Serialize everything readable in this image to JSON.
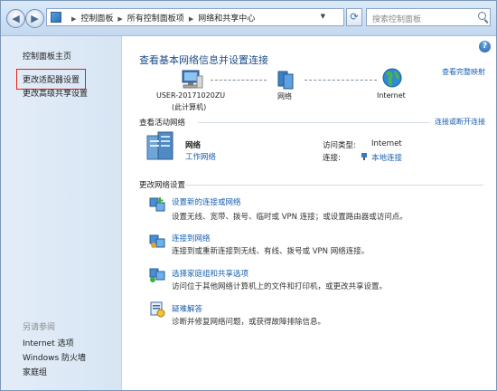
{
  "address_bar": {
    "breadcrumbs": [
      "控制面板",
      "所有控制面板项",
      "网络和共享中心"
    ],
    "search_placeholder": "搜索控制面板"
  },
  "sidebar": {
    "home": "控制面板主页",
    "adapter_settings": "更改适配器设置",
    "advanced_sharing": "更改高级共享设置",
    "see_also_title": "另请参阅",
    "see_also": [
      "Internet 选项",
      "Windows 防火墙",
      "家庭组"
    ]
  },
  "main": {
    "title": "查看基本网络信息并设置连接",
    "view_full_map": "查看完整映射",
    "map": {
      "computer_name": "USER-20171020ZU",
      "computer_sub": "(此计算机)",
      "network": "网络",
      "internet": "Internet"
    },
    "active": {
      "title": "查看活动网络",
      "connect_link": "连接或断开连接",
      "network_name": "网络",
      "network_type": "工作网络",
      "access_type_label": "访问类型:",
      "access_type_value": "Internet",
      "connections_label": "连接:",
      "connections_value": "本地连接"
    },
    "change": {
      "title": "更改网络设置",
      "tasks": [
        {
          "link": "设置新的连接或网络",
          "desc": "设置无线、宽带、拨号、临时或 VPN 连接；或设置路由器或访问点。"
        },
        {
          "link": "连接到网络",
          "desc": "连接到或重新连接到无线、有线、拨号或 VPN 网络连接。"
        },
        {
          "link": "选择家庭组和共享选项",
          "desc": "访问位于其他网络计算机上的文件和打印机，或更改共享设置。"
        },
        {
          "link": "疑难解答",
          "desc": "诊断并修复网络问题，或获得故障排除信息。"
        }
      ]
    }
  },
  "colors": {
    "link": "#1a5fb0",
    "title": "#1c4c89",
    "highlight_box": "#e0201a"
  }
}
